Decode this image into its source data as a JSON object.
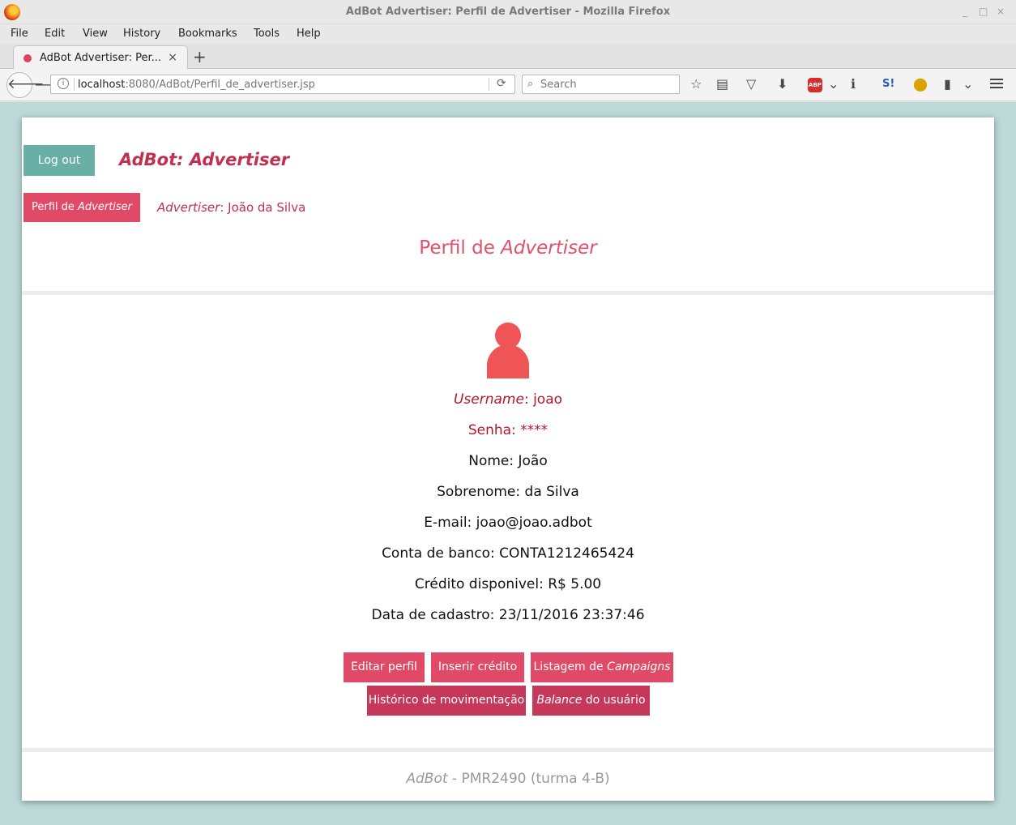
{
  "window": {
    "title": "AdBot Advertiser: Perfil de Advertiser - Mozilla Firefox",
    "controls": [
      "_",
      "□",
      "×"
    ]
  },
  "menu": [
    "File",
    "Edit",
    "View",
    "History",
    "Bookmarks",
    "Tools",
    "Help"
  ],
  "tab": {
    "label": "AdBot Advertiser: Per...",
    "close": "×",
    "new": "+"
  },
  "nav": {
    "url_host": "localhost",
    "url_rest": ":8080/AdBot/Perfil_de_advertiser.jsp",
    "search_placeholder": "Search"
  },
  "page": {
    "logout_label": "Log out",
    "brand": "AdBot: Advertiser",
    "perfil_button": {
      "plain": "Perfil de ",
      "italic": "Advertiser"
    },
    "advertiser": {
      "italic": "Advertiser",
      "rest": ": João da Silva"
    },
    "title": {
      "plain": "Perfil de ",
      "italic": "Advertiser"
    },
    "profile": {
      "username": {
        "label": "Username",
        "value": ": joao"
      },
      "senha": "Senha: ****",
      "nome": "Nome: João",
      "sobrenome": "Sobrenome: da Silva",
      "email": "E-mail: joao@joao.adbot",
      "conta": "Conta de banco: CONTA1212465424",
      "credito": "Crédito disponivel: R$ 5.00",
      "cadastro": "Data de cadastro: 23/11/2016 23:37:46"
    },
    "actions": {
      "editar": "Editar perfil",
      "inserir": "Inserir crédito",
      "listagem": {
        "plain": "Listagem de ",
        "italic": "Campaigns"
      },
      "historico": "Histórico de movimentação",
      "balance": {
        "italic": "Balance",
        "plain": " do usuário"
      }
    },
    "footer": {
      "italic": "AdBot",
      "plain": " - PMR2490 (turma 4-B)"
    }
  },
  "colors": {
    "accent": "#e04a66",
    "teal": "#6aafa6",
    "brand": "#c0304f",
    "avatar": "#ef5557",
    "background": "#bdd9d8"
  }
}
